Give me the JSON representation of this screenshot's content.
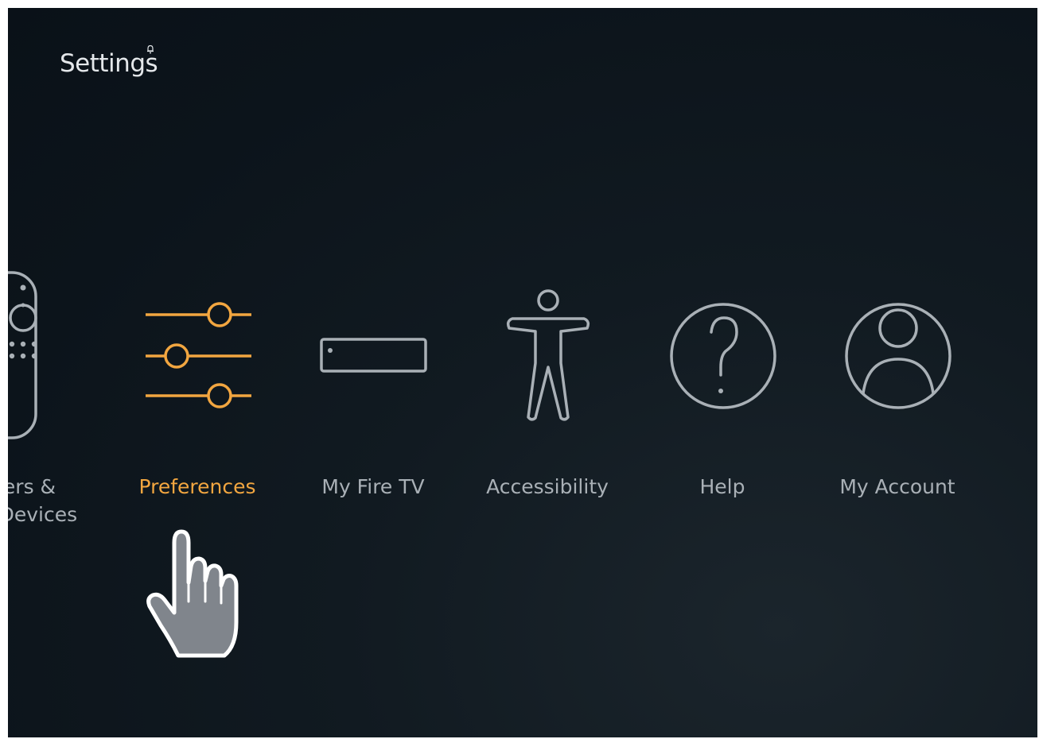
{
  "header": {
    "title": "Settings"
  },
  "menu": {
    "items": [
      {
        "label": "rollers &\nth Devices",
        "icon": "remote-icon",
        "selected": false
      },
      {
        "label": "Preferences",
        "icon": "sliders-icon",
        "selected": true
      },
      {
        "label": "My Fire TV",
        "icon": "fire-tv-device-icon",
        "selected": false
      },
      {
        "label": "Accessibility",
        "icon": "accessibility-person-icon",
        "selected": false
      },
      {
        "label": "Help",
        "icon": "help-question-icon",
        "selected": false
      },
      {
        "label": "My Account",
        "icon": "account-user-icon",
        "selected": false
      }
    ]
  },
  "colors": {
    "background": "#0c141b",
    "accent": "#f2a640",
    "icon_default": "#a9b0b6",
    "title": "#e4e7ea"
  },
  "pointer": {
    "icon": "hand-pointer-icon"
  }
}
